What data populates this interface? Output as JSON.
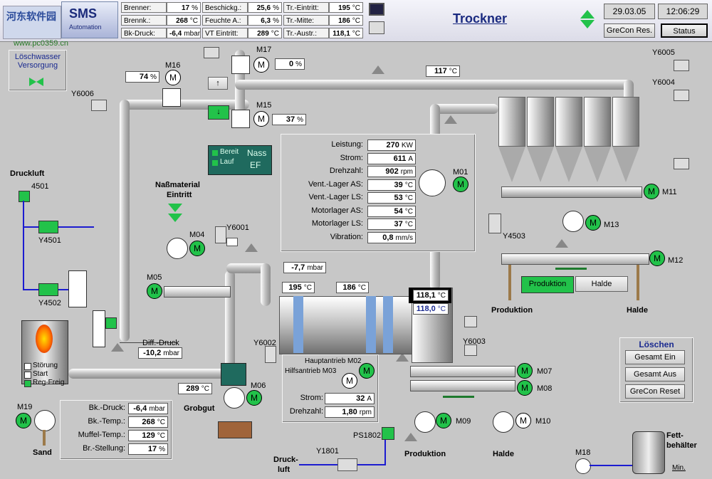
{
  "header": {
    "logo_main": "SMS",
    "logo_sub": "Automation",
    "title": "Trockner",
    "date": "29.03.05",
    "time": "12:06:29",
    "btn_grecon_res": "GreCon Res.",
    "btn_status": "Status",
    "cells": [
      {
        "label": "Brenner:",
        "value": "17",
        "unit": "%"
      },
      {
        "label": "Brennk.:",
        "value": "268",
        "unit": "°C"
      },
      {
        "label": "Bk-Druck:",
        "value": "-6,4",
        "unit": "mbar"
      },
      {
        "label": "Beschickg.:",
        "value": "25,6",
        "unit": "%"
      },
      {
        "label": "Feuchte A.:",
        "value": "6,3",
        "unit": "%"
      },
      {
        "label": "VT Eintritt:",
        "value": "289",
        "unit": "°C"
      },
      {
        "label": "Tr.-Eintritt:",
        "value": "195",
        "unit": "°C"
      },
      {
        "label": "Tr.-Mitte:",
        "value": "186",
        "unit": "°C"
      },
      {
        "label": "Tr.-Austr.:",
        "value": "118,1",
        "unit": "°C"
      }
    ]
  },
  "watermark": {
    "text1": "河东软件园",
    "text2": "www.pc0359.cn"
  },
  "loeschwasser": "Löschwasser Versorgung",
  "tags": {
    "m16": "M16",
    "m17": "M17",
    "m15": "M15",
    "m04": "M04",
    "m05": "M05",
    "m06": "M06",
    "m01": "M01",
    "m02_label": "Hauptantrieb M02",
    "m03_label": "Hilfsantrieb M03",
    "m07": "M07",
    "m08": "M08",
    "m09": "M09",
    "m10": "M10",
    "m11": "M11",
    "m12": "M12",
    "m13": "M13",
    "m18": "M18",
    "m19": "M19",
    "y6006": "Y6006",
    "y6001": "Y6001",
    "y6002": "Y6002",
    "y6003": "Y6003",
    "y6004": "Y6004",
    "y6005": "Y6005",
    "y4501": "Y4501",
    "y4502": "Y4502",
    "y4503": "Y4503",
    "y1801": "Y1801",
    "t4501": "4501",
    "ps1802": "PS1802"
  },
  "values": {
    "m16_pct": "74",
    "m17_pct": "0",
    "m15_pct": "37",
    "top_temp": "117",
    "diff_druck_label": "Diff.-Druck",
    "diff_druck": "-10,2",
    "mid_druck": "-7,7",
    "t_195": "195",
    "t_186": "186",
    "t_out1": "118,1",
    "t_out2": "118,0",
    "t_289": "289"
  },
  "units": {
    "pct": "%",
    "degc": "°C",
    "mbar": "mbar"
  },
  "nass": {
    "bereit": "Bereit",
    "lauf": "Lauf",
    "title1": "Nass",
    "title2": "EF"
  },
  "fan_panel": [
    {
      "label": "Leistung:",
      "value": "270",
      "unit": "KW"
    },
    {
      "label": "Strom:",
      "value": "611",
      "unit": "A"
    },
    {
      "label": "Drehzahl:",
      "value": "902",
      "unit": "rpm"
    },
    {
      "label": "Vent.-Lager AS:",
      "value": "39",
      "unit": "°C"
    },
    {
      "label": "Vent.-Lager LS:",
      "value": "53",
      "unit": "°C"
    },
    {
      "label": "Motorlager AS:",
      "value": "54",
      "unit": "°C"
    },
    {
      "label": "Motorlager LS:",
      "value": "37",
      "unit": "°C"
    },
    {
      "label": "Vibration:",
      "value": "0,8",
      "unit": "mm/s"
    }
  ],
  "drive_panel": [
    {
      "label": "Strom:",
      "value": "32",
      "unit": "A"
    },
    {
      "label": "Drehzahl:",
      "value": "1,80",
      "unit": "rpm"
    }
  ],
  "burner_panel": [
    {
      "label": "Bk.-Druck:",
      "value": "-6,4",
      "unit": "mbar"
    },
    {
      "label": "Bk.-Temp.:",
      "value": "268",
      "unit": "°C"
    },
    {
      "label": "Muffel-Temp.:",
      "value": "129",
      "unit": "°C"
    },
    {
      "label": "Br.-Stellung:",
      "value": "17",
      "unit": "%"
    }
  ],
  "burner_status": {
    "stoerung": "Störung",
    "start": "Start",
    "regfrei": "Reg-Freig."
  },
  "labels": {
    "druckluft": "Druckluft",
    "nassmat1": "Naßmaterial",
    "nassmat2": "Eintritt",
    "grobgut": "Grobgut",
    "sand": "Sand",
    "produktion": "Produktion",
    "halde": "Halde",
    "druck1": "Druck-",
    "druck2": "luft",
    "fett1": "Fett-",
    "fett2": "behälter",
    "min": "Min."
  },
  "switch": {
    "produktion": "Produktion",
    "halde": "Halde"
  },
  "loeschen": {
    "title": "Löschen",
    "ein": "Gesamt Ein",
    "aus": "Gesamt Aus",
    "grecon": "GreCon Reset"
  },
  "colors": {
    "motor_on": "#22c24a",
    "pipe": "#bdbdbd",
    "water_line": "#1c1cd0",
    "title": "#1a2a80"
  }
}
